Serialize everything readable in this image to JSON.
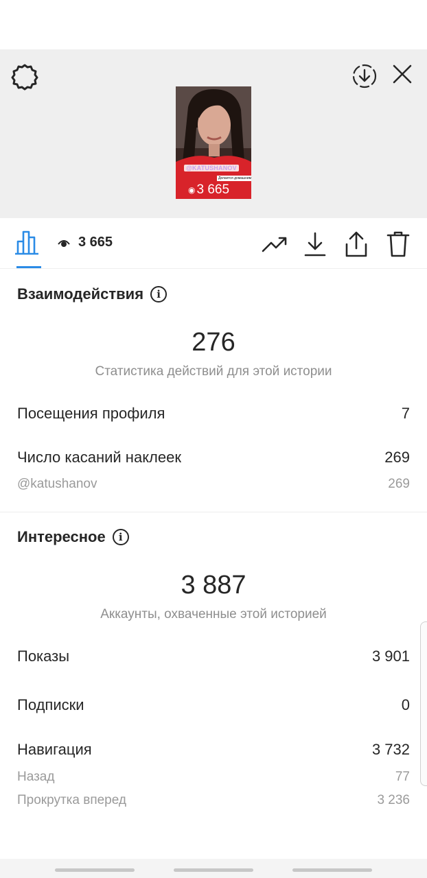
{
  "story": {
    "thumbnail": {
      "mention_sticker": "@KATUSHANOV",
      "shared_text": "Делается домашними",
      "view_count": "3 665"
    }
  },
  "toolbar": {
    "views": "3 665",
    "icons": [
      "bar-chart-icon",
      "eye-icon",
      "trending-up-icon",
      "download-icon",
      "share-icon",
      "trash-icon"
    ]
  },
  "interactions": {
    "title": "Взаимодействия",
    "total": "276",
    "caption": "Статистика действий для этой истории",
    "rows": [
      {
        "label": "Посещения профиля",
        "value": "7"
      },
      {
        "label": "Число касаний наклеек",
        "value": "269"
      }
    ],
    "sub_rows": [
      {
        "label": "@katushanov",
        "value": "269"
      }
    ]
  },
  "discovery": {
    "title": "Интересное",
    "total": "3 887",
    "caption": "Аккаунты, охваченные этой историей",
    "rows": [
      {
        "label": "Показы",
        "value": "3 901"
      },
      {
        "label": "Подписки",
        "value": "0"
      },
      {
        "label": "Навигация",
        "value": "3 732"
      }
    ],
    "sub_rows": [
      {
        "label": "Назад",
        "value": "77"
      },
      {
        "label": "Прокрутка вперед",
        "value": "3 236"
      }
    ]
  },
  "colors": {
    "accent": "#2a8be6",
    "text": "#262626",
    "muted": "#8e8e8e",
    "header_bg": "#efefef"
  }
}
